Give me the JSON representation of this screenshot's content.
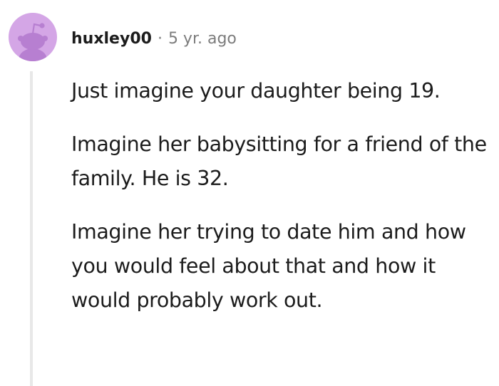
{
  "comment": {
    "author": "huxley00",
    "separator": "·",
    "timestamp": "5 yr. ago",
    "paragraphs": [
      "Just imagine your daughter being 19.",
      "Imagine her babysitting for a friend of the family. He is 32.",
      "Imagine her trying to date him and how you would feel about that and how it would probably work out."
    ]
  },
  "colors": {
    "avatar_bg": "#d4a6e6",
    "avatar_figure": "#b77fd1",
    "thread_line": "#e8e8e8",
    "text": "#1c1c1c",
    "meta": "#7c7c7c"
  },
  "icons": {
    "avatar": "reddit-snoo-avatar"
  }
}
